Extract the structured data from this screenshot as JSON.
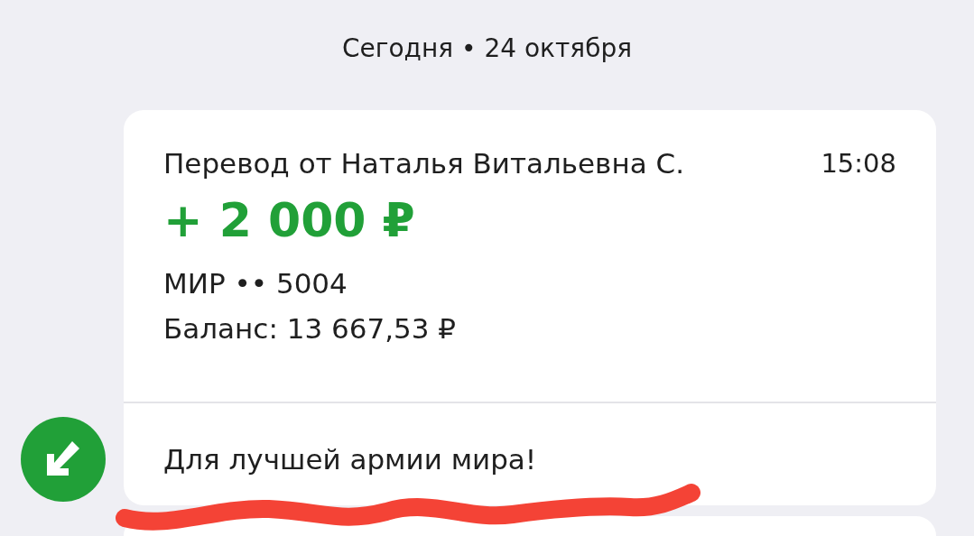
{
  "date_header": "Сегодня • 24 октября",
  "transaction": {
    "title": "Перевод от Наталья Витальевна С.",
    "time": "15:08",
    "amount": "+ 2 000 ₽",
    "card": "МИР •• 5004",
    "balance": "Баланс: 13 667,53 ₽",
    "message": "Для лучшей армии мира!"
  }
}
